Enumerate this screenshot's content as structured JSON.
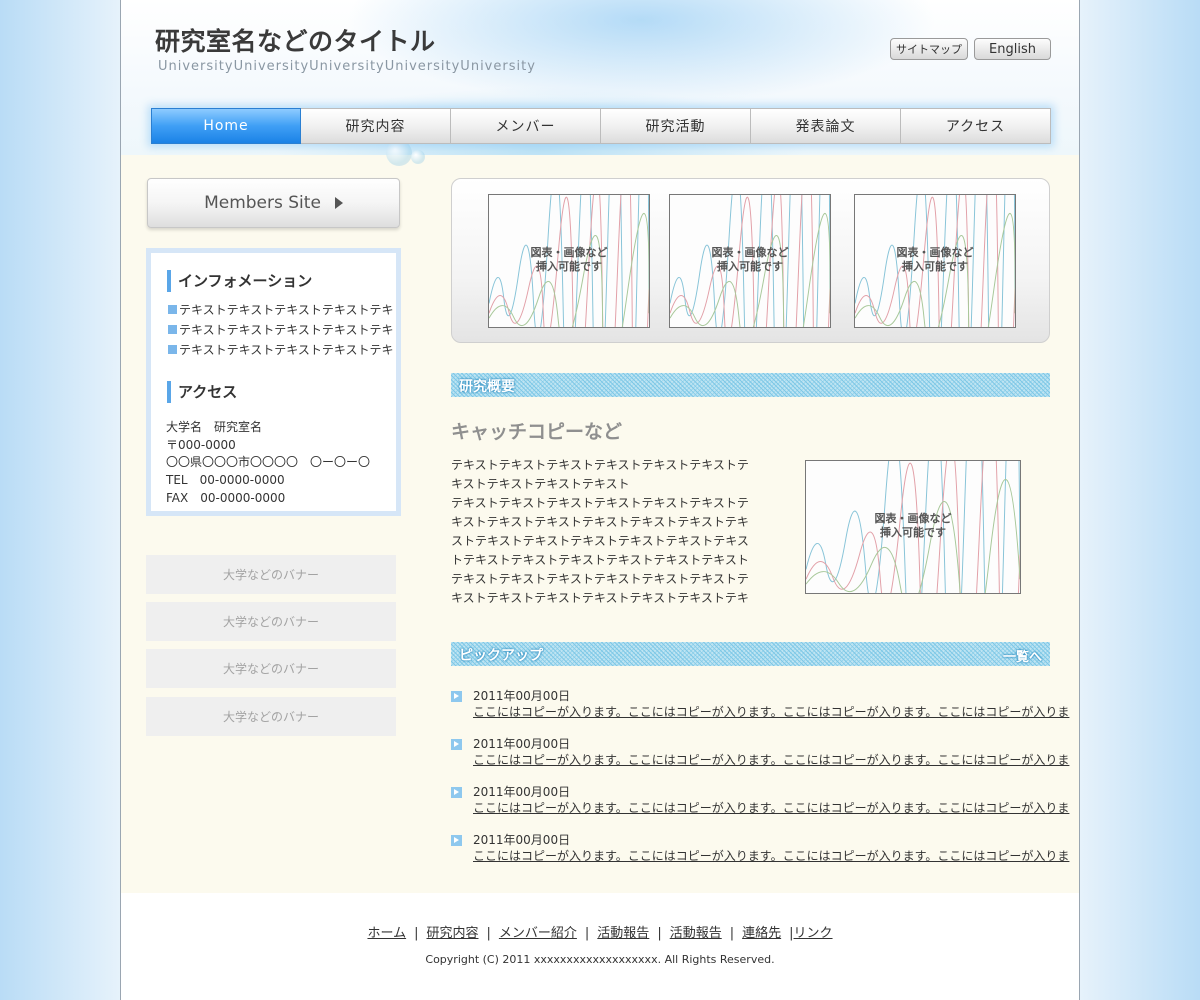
{
  "header": {
    "title": "研究室名などのタイトル",
    "subtitle": "UniversityUniversityUniversityUniversityUniversity",
    "sitemap_label": "サイトマップ",
    "english_label": "English"
  },
  "nav": {
    "items": [
      {
        "label": "Home"
      },
      {
        "label": "研究内容"
      },
      {
        "label": "メンバー"
      },
      {
        "label": "研究活動"
      },
      {
        "label": "発表論文"
      },
      {
        "label": "アクセス"
      }
    ],
    "active_index": 0
  },
  "sidebar": {
    "members_button": "Members Site",
    "info_heading": "インフォメーション",
    "info_items": [
      "テキストテキストテキストテキストテキ",
      "テキストテキストテキストテキストテキ",
      "テキストテキストテキストテキストテキ"
    ],
    "access_heading": "アクセス",
    "address": [
      "大学名　研究室名",
      "〒000-0000",
      "〇〇県〇〇〇市〇〇〇〇　〇ー〇ー〇",
      "TEL　00-0000-0000",
      "FAX　00-0000-0000"
    ],
    "banners": [
      "大学などのバナー",
      "大学などのバナー",
      "大学などのバナー",
      "大学などのバナー"
    ]
  },
  "main": {
    "placeholder_line1": "図表・画像など",
    "placeholder_line2": "挿入可能です",
    "overview_heading": "研究概要",
    "catch_copy": "キャッチコピーなど",
    "body_lines": [
      "テキストテキストテキストテキストテキストテキストテ",
      "キストテキストテキストテキスト",
      "テキストテキストテキストテキストテキストテキストテ",
      "キストテキストテキストテキストテキストテキストテキ",
      "ストテキストテキストテキストテキストテキストテキス",
      "トテキストテキストテキストテキストテキストテキスト",
      "テキストテキストテキストテキストテキストテキストテ",
      "キストテキストテキストテキストテキストテキストテキ"
    ],
    "pickup_heading": "ピックアップ",
    "pickup_more": "一覧へ",
    "news": [
      {
        "date": "2011年00月00日",
        "text": "ここにはコピーが入ります。ここにはコピーが入ります。ここにはコピーが入ります。ここにはコピーが入りま"
      },
      {
        "date": "2011年00月00日",
        "text": "ここにはコピーが入ります。ここにはコピーが入ります。ここにはコピーが入ります。ここにはコピーが入りま"
      },
      {
        "date": "2011年00月00日",
        "text": "ここにはコピーが入ります。ここにはコピーが入ります。ここにはコピーが入ります。ここにはコピーが入りま"
      },
      {
        "date": "2011年00月00日",
        "text": "ここにはコピーが入ります。ここにはコピーが入ります。ここにはコピーが入ります。ここにはコピーが入りま"
      }
    ]
  },
  "footer": {
    "links": [
      "ホーム",
      "研究内容",
      "メンバー紹介",
      "活動報告",
      "活動報告",
      "連絡先",
      "リンク"
    ],
    "copyright": "Copyright (C) 2011 xxxxxxxxxxxxxxxxxxx. All Rights Reserved."
  },
  "colors": {
    "nav_active": "#3f9ff5",
    "accent_blue": "#5aa6e8",
    "section_head": "#7fc8e6",
    "page_bg": "#fcfaee"
  }
}
